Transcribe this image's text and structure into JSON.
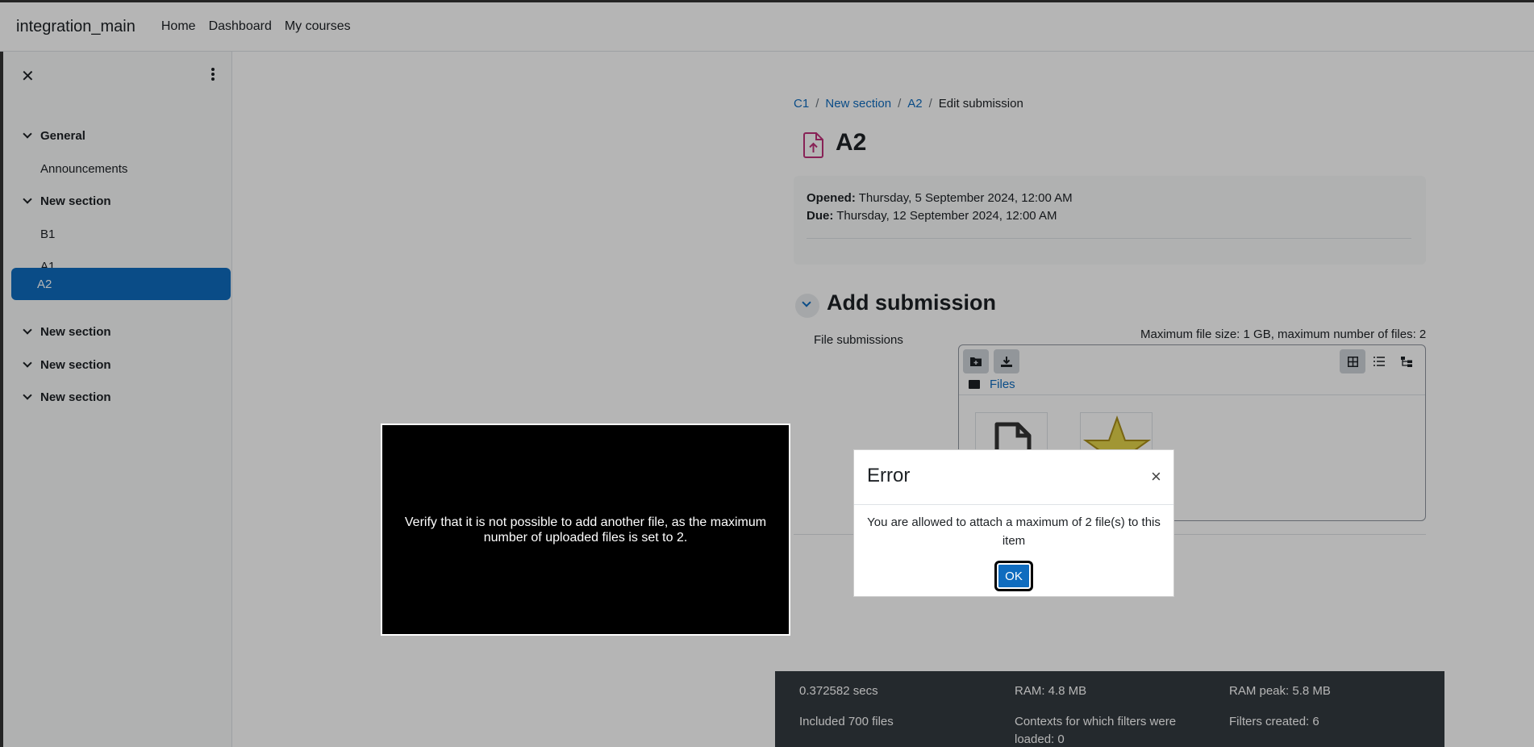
{
  "navbar": {
    "brand": "integration_main",
    "links": [
      "Home",
      "Dashboard",
      "My courses"
    ]
  },
  "drawer": {
    "close_glyph": "✕",
    "items": [
      {
        "label": "General",
        "type": "section"
      },
      {
        "label": "Announcements",
        "type": "activity"
      },
      {
        "label": "New section",
        "type": "section"
      },
      {
        "label": "B1",
        "type": "activity"
      },
      {
        "label": "A1",
        "type": "activity"
      },
      {
        "label": "A2",
        "type": "activity",
        "active": true
      },
      {
        "label": "New section",
        "type": "section"
      },
      {
        "label": "New section",
        "type": "section"
      },
      {
        "label": "New section",
        "type": "section"
      }
    ]
  },
  "breadcrumb": [
    "C1",
    "New section",
    "A2",
    "Edit submission"
  ],
  "page": {
    "title": "A2",
    "opened_label": "Opened:",
    "opened_value": " Thursday, 5 September 2024, 12:00 AM",
    "due_label": "Due:",
    "due_value": " Thursday, 12 September 2024, 12:00 AM"
  },
  "submission": {
    "heading": "Add submission",
    "field_label": "File submissions",
    "max_info": "Maximum file size: 1 GB, maximum number of files: 2",
    "path_label": "Files"
  },
  "footer": {
    "time": "0.372582 secs",
    "ram": "RAM: 4.8 MB",
    "ram_peak": "RAM peak: 5.8 MB",
    "included": "Included 700 files",
    "contexts": "Contexts for which filters were loaded: 0",
    "filters": "Filters created: 6"
  },
  "modal": {
    "title": "Error",
    "close_glyph": "×",
    "message": "You are allowed to attach a maximum of 2 file(s) to this item",
    "ok_label": "OK"
  },
  "instruction": "Verify that it is not possible to add another file, as the maximum number of uploaded files is set to 2.",
  "colors": {
    "accent": "#0f6cbf",
    "footer_bg": "#343a40",
    "backdrop": "rgba(0,0,0,0.29)"
  }
}
